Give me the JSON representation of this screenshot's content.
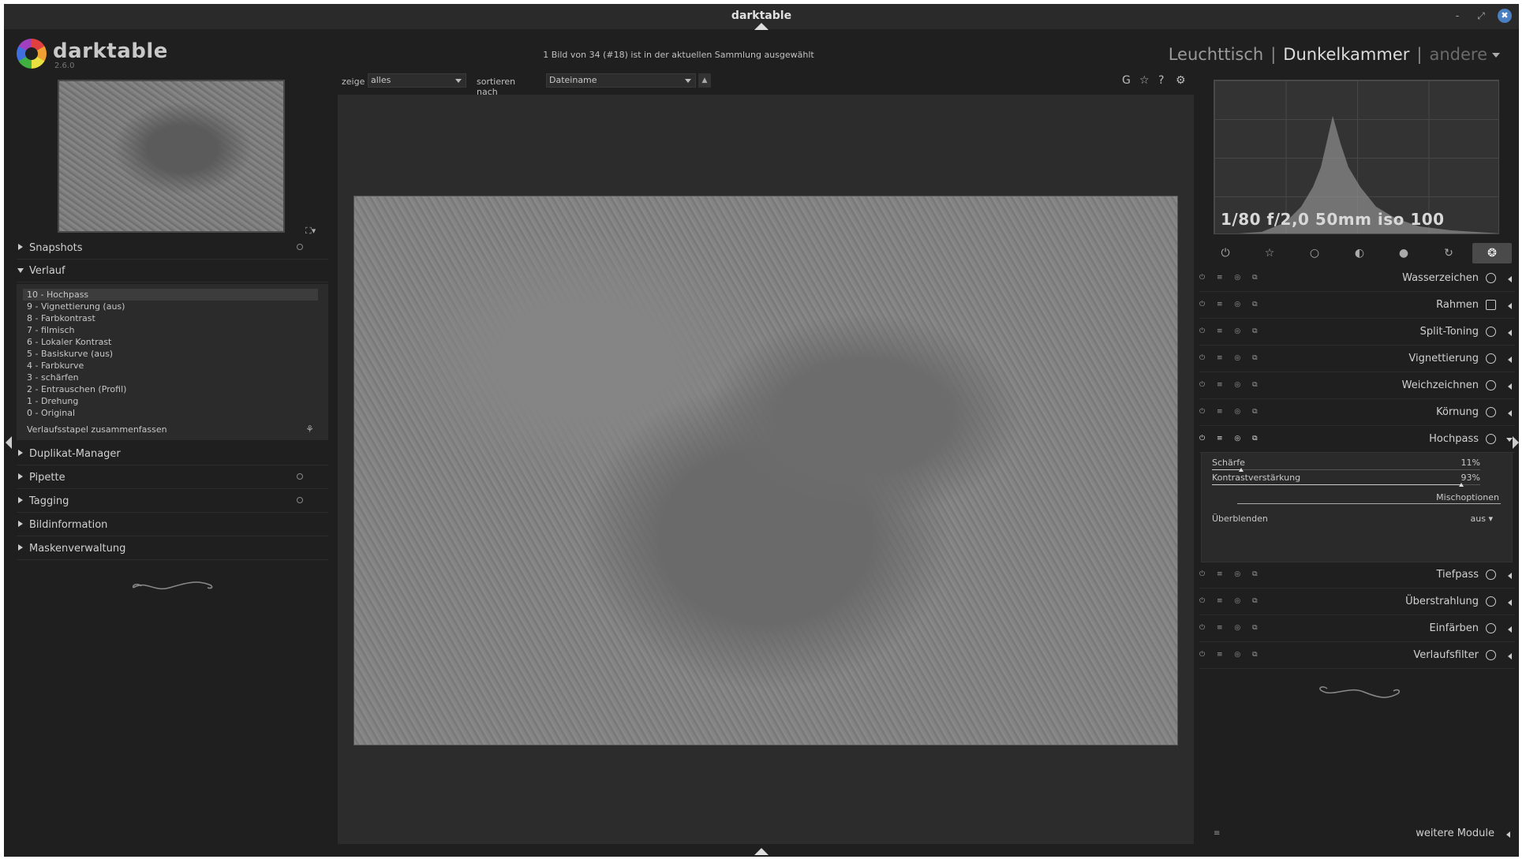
{
  "window": {
    "title": "darktable",
    "controls": [
      "-",
      "⤢",
      "✖"
    ]
  },
  "header": {
    "app_name": "darktable",
    "version": "2.6.0",
    "status": "1 Bild von 34 (#18) ist in der aktuellen Sammlung ausgewählt",
    "views": {
      "lighttable": "Leuchttisch",
      "darkroom": "Dunkelkammer",
      "other": "andere",
      "separator": "|"
    }
  },
  "filterbar": {
    "show_label": "zeige",
    "show_value": "alles",
    "sort_label": "sortieren nach",
    "sort_value": "Dateiname",
    "sort_dir": "▲",
    "icons": [
      "G",
      "☆",
      "?",
      "⚙"
    ]
  },
  "left_panel": {
    "zoom_icon": "⛶▾",
    "modules": {
      "snapshots": "Snapshots",
      "history": "Verlauf",
      "duplicate": "Duplikat-Manager",
      "pipette": "Pipette",
      "tagging": "Tagging",
      "image_info": "Bildinformation",
      "mask_manager": "Maskenverwaltung"
    },
    "history_items": [
      "10 - Hochpass",
      "9 - Vignettierung (aus)",
      "8 - Farbkontrast",
      "7 - filmisch",
      "6 - Lokaler Kontrast",
      "5 - Basiskurve (aus)",
      "4 - Farbkurve",
      "3 - schärfen",
      "2 - Entrauschen (Profil)",
      "1 - Drehung",
      "0 - Original"
    ],
    "history_selected": 0,
    "compress_label": "Verlaufsstapel zusammenfassen",
    "compress_icon": "⚘"
  },
  "right_panel": {
    "exif": "1/80 f/2,0 50mm iso 100",
    "module_group_icons": [
      "⏻",
      "☆",
      "○",
      "◐",
      "●",
      "↻",
      "❂"
    ],
    "active_group": 6,
    "module_ctrl_icons": "⏻ ≡ ◎ ⧉",
    "modules": [
      {
        "name": "Wasserzeichen",
        "icon": "watermark-icon"
      },
      {
        "name": "Rahmen",
        "icon": "frame-icon"
      },
      {
        "name": "Split-Toning",
        "icon": "split-toning-icon"
      },
      {
        "name": "Vignettierung",
        "icon": "vignette-icon"
      },
      {
        "name": "Weichzeichnen",
        "icon": "soften-icon"
      },
      {
        "name": "Körnung",
        "icon": "grain-icon"
      },
      {
        "name": "Hochpass",
        "icon": "highpass-icon"
      }
    ],
    "modules_after": [
      {
        "name": "Tiefpass",
        "icon": "lowpass-icon"
      },
      {
        "name": "Überstrahlung",
        "icon": "bloom-icon"
      },
      {
        "name": "Einfärben",
        "icon": "colorize-icon"
      },
      {
        "name": "Verlaufsfilter",
        "icon": "graduated-filter-icon"
      }
    ],
    "highpass": {
      "sharpness_label": "Schärfe",
      "sharpness_value": "11%",
      "sharpness": 0.11,
      "contrast_label": "Kontrastverstärkung",
      "contrast_value": "93%",
      "contrast": 0.93,
      "mix_label": "Mischoptionen",
      "blend_label": "Überblenden",
      "blend_value": "aus ▾"
    },
    "more_modules_label": "weitere Module",
    "more_modules_icon": "≡"
  }
}
